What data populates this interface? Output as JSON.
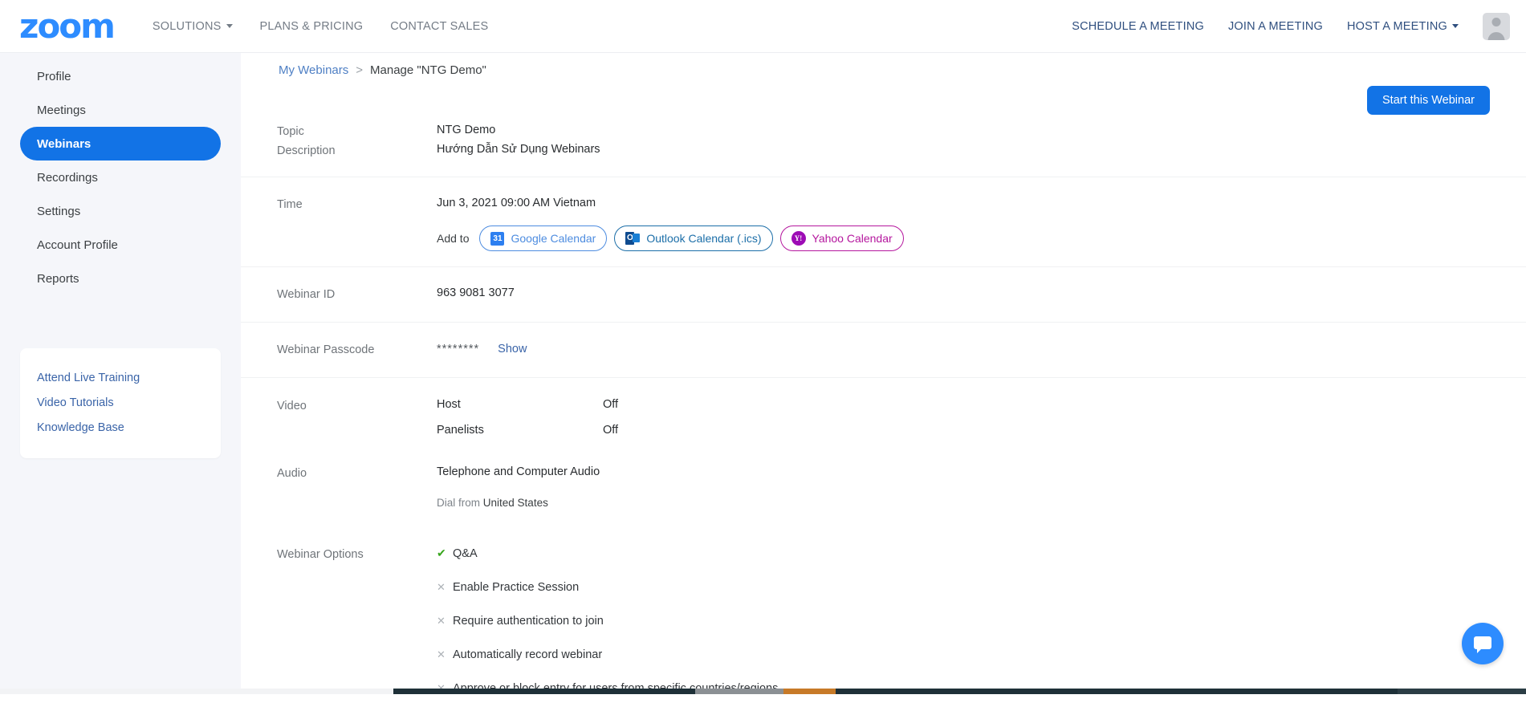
{
  "header": {
    "logo_text": "zoom",
    "nav_left": [
      {
        "label": "SOLUTIONS",
        "has_caret": true
      },
      {
        "label": "PLANS & PRICING",
        "has_caret": false
      },
      {
        "label": "CONTACT SALES",
        "has_caret": false
      }
    ],
    "nav_right": [
      {
        "label": "SCHEDULE A MEETING",
        "has_caret": false
      },
      {
        "label": "JOIN A MEETING",
        "has_caret": false
      },
      {
        "label": "HOST A MEETING",
        "has_caret": true
      }
    ],
    "avatar_icon": "user-avatar-icon"
  },
  "sidebar": {
    "items": [
      {
        "label": "Profile",
        "active": false
      },
      {
        "label": "Meetings",
        "active": false
      },
      {
        "label": "Webinars",
        "active": true
      },
      {
        "label": "Recordings",
        "active": false
      },
      {
        "label": "Settings",
        "active": false
      },
      {
        "label": "Account Profile",
        "active": false
      },
      {
        "label": "Reports",
        "active": false
      }
    ],
    "help_links": [
      {
        "label": "Attend Live Training"
      },
      {
        "label": "Video Tutorials"
      },
      {
        "label": "Knowledge Base"
      }
    ]
  },
  "content": {
    "breadcrumb": {
      "root": "My Webinars",
      "separator": ">",
      "current": "Manage \"NTG Demo\""
    },
    "start_button": "Start this Webinar",
    "rows": {
      "topic": {
        "label": "Topic",
        "value": "NTG Demo"
      },
      "description": {
        "label": "Description",
        "value": "Hướng Dẫn Sử Dụng Webinars"
      },
      "time": {
        "label": "Time",
        "value": "Jun 3, 2021 09:00 AM Vietnam",
        "add_to_label": "Add to",
        "calendars": [
          {
            "label": "Google Calendar",
            "icon": "google-calendar-icon",
            "glyph": "31"
          },
          {
            "label": "Outlook Calendar (.ics)",
            "icon": "outlook-calendar-icon",
            "glyph": "O"
          },
          {
            "label": "Yahoo Calendar",
            "icon": "yahoo-calendar-icon",
            "glyph": "Y!"
          }
        ]
      },
      "webinar_id": {
        "label": "Webinar ID",
        "value": "963 9081 3077"
      },
      "passcode": {
        "label": "Webinar Passcode",
        "masked": "********",
        "show_link": "Show"
      },
      "video": {
        "label": "Video",
        "entries": [
          {
            "who": "Host",
            "state": "Off"
          },
          {
            "who": "Panelists",
            "state": "Off"
          }
        ]
      },
      "audio": {
        "label": "Audio",
        "value": "Telephone and Computer Audio",
        "dial_prefix": "Dial from",
        "dial_country": "United States"
      },
      "webinar_options": {
        "label": "Webinar Options",
        "options": [
          {
            "label": "Q&A",
            "enabled": true
          },
          {
            "label": "Enable Practice Session",
            "enabled": false
          },
          {
            "label": "Require authentication to join",
            "enabled": false
          },
          {
            "label": "Automatically record webinar",
            "enabled": false
          },
          {
            "label": "Approve or block entry for users from specific countries/regions",
            "enabled": false
          }
        ]
      }
    }
  },
  "chat_widget": {
    "icon": "chat-bubble-icon"
  },
  "colors": {
    "brand_blue": "#2d8cff",
    "action_blue": "#1273e6",
    "link_blue": "#3a64a8",
    "sidebar_bg": "#f5f6fa",
    "check_green": "#37a51c",
    "cross_gray": "#adb2b7",
    "yahoo_purple": "#b5179e"
  }
}
